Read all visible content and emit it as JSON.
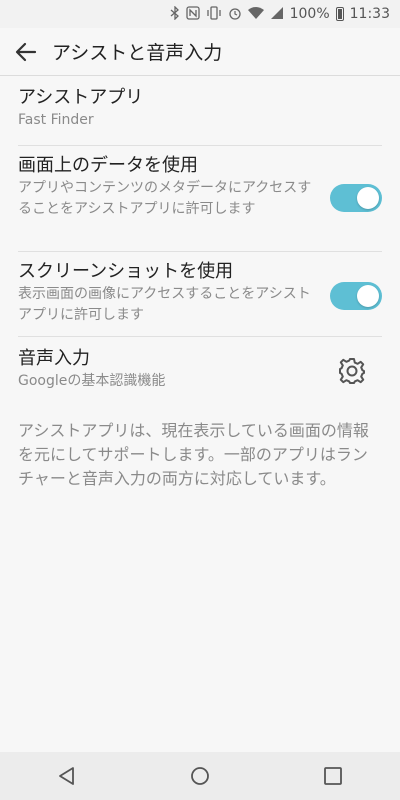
{
  "status_bar": {
    "icons": [
      "bluetooth-icon",
      "nfc-icon",
      "vibrate-icon",
      "alarm-icon",
      "wifi-icon",
      "signal-icon"
    ],
    "battery": "100%",
    "time": "11:33"
  },
  "app_bar": {
    "title": "アシストと音声入力"
  },
  "settings": {
    "assist_app": {
      "title": "アシストアプリ",
      "value": "Fast Finder"
    },
    "screen_data": {
      "title": "画面上のデータを使用",
      "summary": "アプリやコンテンツのメタデータにアクセスすることをアシストアプリに許可します",
      "enabled": true
    },
    "screenshot": {
      "title": "スクリーンショットを使用",
      "summary": "表示画面の画像にアクセスすることをアシストアプリに許可します",
      "enabled": true
    },
    "voice_input": {
      "title": "音声入力",
      "value": "Googleの基本認識機能"
    }
  },
  "note": "アシストアプリは、現在表示している画面の情報を元にしてサポートします。一部のアプリはランチャーと音声入力の両方に対応しています。",
  "colors": {
    "toggle_on": "#5ebfd4",
    "background": "#f7f7f7"
  }
}
